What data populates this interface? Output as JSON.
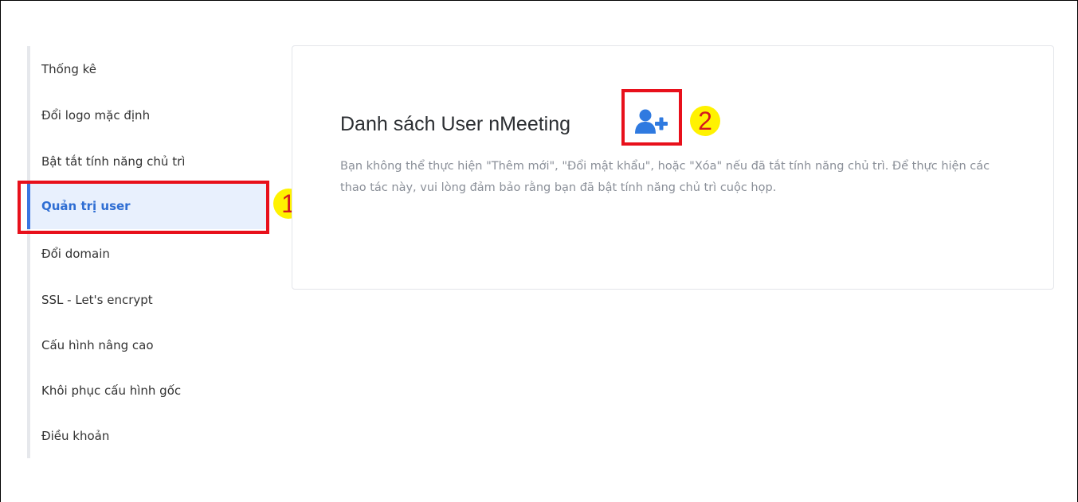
{
  "sidebar": {
    "items": [
      {
        "label": "Thống kê"
      },
      {
        "label": "Đổi logo mặc định"
      },
      {
        "label": "Bật tắt tính năng chủ trì"
      },
      {
        "label": "Quản trị user",
        "active": true
      },
      {
        "label": "Đổi domain"
      },
      {
        "label": "SSL - Let's encrypt"
      },
      {
        "label": "Cấu hình nâng cao"
      },
      {
        "label": "Khôi phục cấu hình gốc"
      },
      {
        "label": "Điều khoản"
      }
    ]
  },
  "main": {
    "title": "Danh sách User nMeeting",
    "add_user_icon": "user-plus-icon",
    "note": "Bạn không thể thực hiện \"Thêm mới\", \"Đổi mật khẩu\", hoặc \"Xóa\" nếu đã tắt tính năng chủ trì. Để thực hiện các thao tác này, vui lòng đảm bảo rằng bạn đã bật tính năng chủ trì cuộc họp."
  },
  "annotations": {
    "step1": "1",
    "step2": "2"
  },
  "colors": {
    "accent": "#3b76e0",
    "active_bg": "#e8f0fd",
    "annotation_red": "#e8101b",
    "annotation_yellow": "#fff200"
  }
}
